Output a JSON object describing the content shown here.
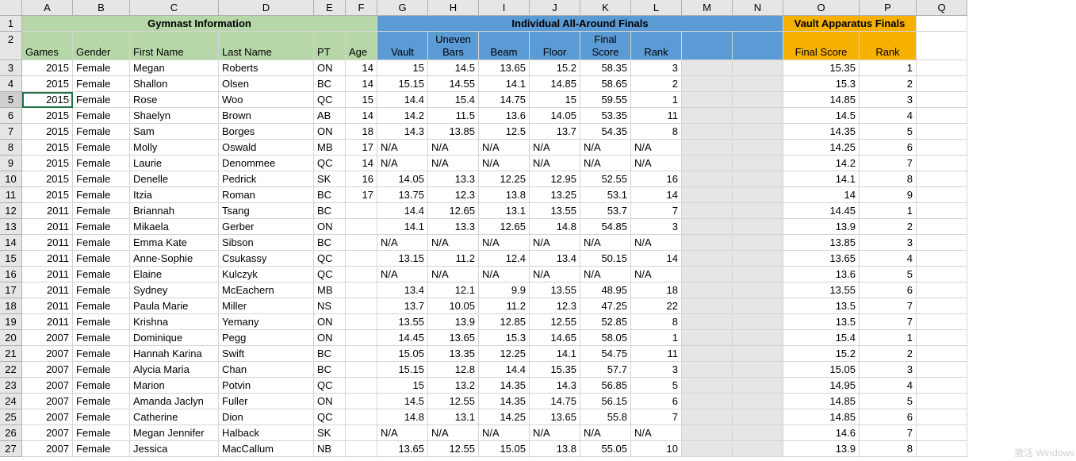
{
  "columns": [
    "A",
    "B",
    "C",
    "D",
    "E",
    "F",
    "G",
    "H",
    "I",
    "J",
    "K",
    "L",
    "M",
    "N",
    "O",
    "P",
    "Q"
  ],
  "header1": {
    "gymnast_info": "Gymnast Information",
    "individual_aa": "Individual All-Around Finals",
    "vault_finals": "Vault Apparatus Finals"
  },
  "header2": {
    "games": "Games",
    "gender": "Gender",
    "first": "First Name",
    "last": "Last Name",
    "pt": "PT",
    "age": "Age",
    "vault": "Vault",
    "uneven": "Uneven",
    "bars": "Bars",
    "beam": "Beam",
    "floor": "Floor",
    "final": "Final",
    "score": "Score",
    "rank": "Rank",
    "final_score": "Final Score",
    "vrank": "Rank"
  },
  "chart_data": {
    "type": "table",
    "columns": [
      "Games",
      "Gender",
      "First Name",
      "Last Name",
      "PT",
      "Age",
      "Vault",
      "Uneven Bars",
      "Beam",
      "Floor",
      "Final Score",
      "Rank",
      "Vault Final Score",
      "Vault Rank"
    ],
    "rows": [
      [
        2015,
        "Female",
        "Megan",
        "Roberts",
        "ON",
        14,
        15,
        14.5,
        13.65,
        15.2,
        58.35,
        3,
        15.35,
        1
      ],
      [
        2015,
        "Female",
        "Shallon",
        "Olsen",
        "BC",
        14,
        15.15,
        14.55,
        14.1,
        14.85,
        58.65,
        2,
        15.3,
        2
      ],
      [
        2015,
        "Female",
        "Rose",
        "Woo",
        "QC",
        15,
        14.4,
        15.4,
        14.75,
        15,
        59.55,
        1,
        14.85,
        3
      ],
      [
        2015,
        "Female",
        "Shaelyn",
        "Brown",
        "AB",
        14,
        14.2,
        11.5,
        13.6,
        14.05,
        53.35,
        11,
        14.5,
        4
      ],
      [
        2015,
        "Female",
        "Sam",
        "Borges",
        "ON",
        18,
        14.3,
        13.85,
        12.5,
        13.7,
        54.35,
        8,
        14.35,
        5
      ],
      [
        2015,
        "Female",
        "Molly",
        "Oswald",
        "MB",
        17,
        "N/A",
        "N/A",
        "N/A",
        "N/A",
        "N/A",
        "N/A",
        14.25,
        6
      ],
      [
        2015,
        "Female",
        "Laurie",
        "Denommee",
        "QC",
        14,
        "N/A",
        "N/A",
        "N/A",
        "N/A",
        "N/A",
        "N/A",
        14.2,
        7
      ],
      [
        2015,
        "Female",
        "Denelle",
        "Pedrick",
        "SK",
        16,
        14.05,
        13.3,
        12.25,
        12.95,
        52.55,
        16,
        14.1,
        8
      ],
      [
        2015,
        "Female",
        "Itzia",
        "Roman",
        "BC",
        17,
        13.75,
        12.3,
        13.8,
        13.25,
        53.1,
        14,
        14,
        9
      ],
      [
        2011,
        "Female",
        "Briannah",
        "Tsang",
        "BC",
        "",
        14.4,
        12.65,
        13.1,
        13.55,
        53.7,
        7,
        14.45,
        1
      ],
      [
        2011,
        "Female",
        "Mikaela",
        "Gerber",
        "ON",
        "",
        14.1,
        13.3,
        12.65,
        14.8,
        54.85,
        3,
        13.9,
        2
      ],
      [
        2011,
        "Female",
        "Emma Kate",
        "Sibson",
        "BC",
        "",
        "N/A",
        "N/A",
        "N/A",
        "N/A",
        "N/A",
        "N/A",
        13.85,
        3
      ],
      [
        2011,
        "Female",
        "Anne-Sophie",
        "Csukassy",
        "QC",
        "",
        13.15,
        11.2,
        12.4,
        13.4,
        50.15,
        14,
        13.65,
        4
      ],
      [
        2011,
        "Female",
        "Elaine",
        "Kulczyk",
        "QC",
        "",
        "N/A",
        "N/A",
        "N/A",
        "N/A",
        "N/A",
        "N/A",
        13.6,
        5
      ],
      [
        2011,
        "Female",
        "Sydney",
        "McEachern",
        "MB",
        "",
        13.4,
        12.1,
        9.9,
        13.55,
        48.95,
        18,
        13.55,
        6
      ],
      [
        2011,
        "Female",
        "Paula Marie",
        "Miller",
        "NS",
        "",
        13.7,
        10.05,
        11.2,
        12.3,
        47.25,
        22,
        13.5,
        7
      ],
      [
        2011,
        "Female",
        "Krishna",
        "Yemany",
        "ON",
        "",
        13.55,
        13.9,
        12.85,
        12.55,
        52.85,
        8,
        13.5,
        7
      ],
      [
        2007,
        "Female",
        "Dominique",
        "Pegg",
        "ON",
        "",
        14.45,
        13.65,
        15.3,
        14.65,
        58.05,
        1,
        15.4,
        1
      ],
      [
        2007,
        "Female",
        "Hannah Karina",
        "Swift",
        "BC",
        "",
        15.05,
        13.35,
        12.25,
        14.1,
        54.75,
        11,
        15.2,
        2
      ],
      [
        2007,
        "Female",
        "Alycia Maria",
        "Chan",
        "BC",
        "",
        15.15,
        12.8,
        14.4,
        15.35,
        57.7,
        3,
        15.05,
        3
      ],
      [
        2007,
        "Female",
        "Marion",
        "Potvin",
        "QC",
        "",
        15,
        13.2,
        14.35,
        14.3,
        56.85,
        5,
        14.95,
        4
      ],
      [
        2007,
        "Female",
        "Amanda Jaclyn",
        "Fuller",
        "ON",
        "",
        14.5,
        12.55,
        14.35,
        14.75,
        56.15,
        6,
        14.85,
        5
      ],
      [
        2007,
        "Female",
        "Catherine",
        "Dion",
        "QC",
        "",
        14.8,
        13.1,
        14.25,
        13.65,
        55.8,
        7,
        14.85,
        6
      ],
      [
        2007,
        "Female",
        "Megan Jennifer",
        "Halback",
        "SK",
        "",
        "N/A",
        "N/A",
        "N/A",
        "N/A",
        "N/A",
        "N/A",
        14.6,
        7
      ],
      [
        2007,
        "Female",
        "Jessica",
        "MacCallum",
        "NB",
        "",
        13.65,
        12.55,
        15.05,
        13.8,
        55.05,
        10,
        13.9,
        8
      ]
    ]
  },
  "watermark": "激活 Windows",
  "selectedRow": 5
}
